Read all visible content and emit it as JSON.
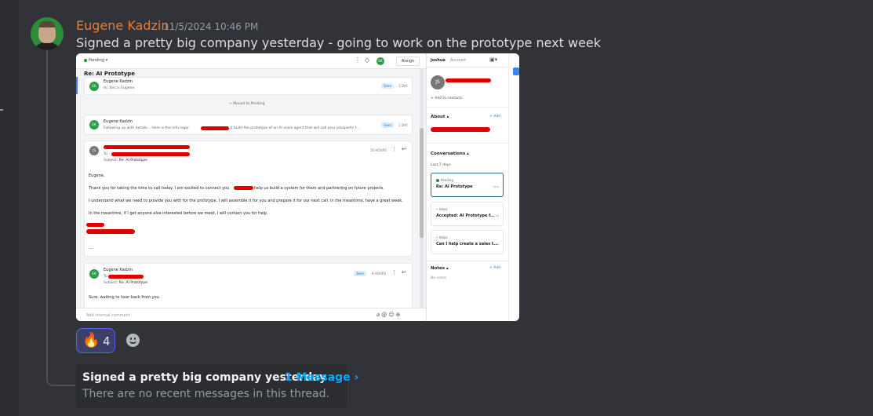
{
  "message": {
    "author": "Eugene Kadzin",
    "timestamp": "11/5/2024 10:46 PM",
    "content": "Signed a pretty big company yesterday - going to work on the prototype next week",
    "author_color": "#e67e3a"
  },
  "attachment": {
    "header": {
      "status": "Pending",
      "assign_label": "Assign",
      "assignee_initials": "EK"
    },
    "subject": "Re: AI Prototype",
    "thread": [
      {
        "initials": "EK",
        "sender": "Eugene Kadzin",
        "preview": "Hi, this is Eugene.",
        "badge": "Seen",
        "time": "1 DAY"
      },
      {
        "event": "Moved to Pending"
      },
      {
        "initials": "EK",
        "sender": "Eugene Kadzin",
        "preview": "Following up with details... Here is the info regar",
        "preview_tail": "ll build the prototype of an AI voice agent that will call your prospects f...",
        "badge": "Seen",
        "time": "1 DAY"
      },
      {
        "initials": "JS",
        "to_label": "To:",
        "subject_label": "Subject:",
        "subject": "Re: AI Prototype",
        "time": "16 HOURS",
        "greeting": "Eugene,",
        "line1": "Thank you for taking the time to call today. I am excited to connect you",
        "line1_tail": "help us build a system for them and partnering on future projects.",
        "line2": "I understand what we need to provide you with for the prototype. I will assemble it for you and prepare it for our next call. In the meantime, have a great week.",
        "line3": "In the meantime, if I get anyone else interested before we meet, I will contact you for help.",
        "ellipsis": "...."
      },
      {
        "initials": "EK",
        "sender": "Eugene Kadzin",
        "to_label": "To",
        "subject_label": "Subject:",
        "subject": "Re: AI Prototype",
        "badge": "Seen",
        "time": "8 HOURS",
        "body": "Sure, waiting to hear back from you."
      }
    ],
    "compose_placeholder": "Add internal comment",
    "sidebar": {
      "tabs": [
        "Joshua",
        "Account"
      ],
      "contact_initials": "JS",
      "add_to_contacts": "+ Add to contacts",
      "about_label": "About",
      "add_label": "+ Add",
      "conversations_label": "Conversations",
      "period_label": "Last 7 days",
      "conversations": [
        {
          "status": "Pending",
          "subject": "Re: AI Prototype",
          "age": "14m"
        },
        {
          "status": "Inbox",
          "subject": "Accepted: AI Prototype f...",
          "age": "1d"
        },
        {
          "status": "Inbox",
          "subject": "Can I help create a sales t...",
          "age": "1d"
        }
      ],
      "notes_label": "Notes",
      "notes_empty": "No notes"
    }
  },
  "reactions": [
    {
      "emoji": "🔥",
      "count": "4"
    }
  ],
  "thread_preview": {
    "title": "Signed a pretty big company yesterday -",
    "link": "1 Message ›",
    "empty_text": "There are no recent messages in this thread."
  }
}
